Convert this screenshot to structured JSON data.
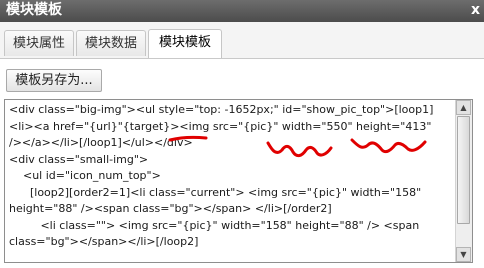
{
  "dialog": {
    "title": "模块模板",
    "close_glyph": "x"
  },
  "tabs": [
    {
      "label": "模块属性",
      "active": false
    },
    {
      "label": "模块数据",
      "active": false
    },
    {
      "label": "模块模板",
      "active": true
    }
  ],
  "toolbar": {
    "save_as_label": "模板另存为..."
  },
  "editor": {
    "lines": [
      "<div class=\"big-img\"><ul style=\"top: -1652px;\" id=\"show_pic_top\">[loop1]",
      "<li><a href=\"{url}\"{target}><img src=\"{pic}\" width=\"550\" height=\"413\"",
      "/></a></li>[/loop1]</ul></div>",
      "<div class=\"small-img\">",
      "    <ul id=\"icon_num_top\">",
      "      [loop2][order2=1]<li class=\"current\"> <img src=\"{pic}\" width=\"158\"",
      "height=\"88\" /><span class=\"bg\"></span> </li>[/order2]",
      "         <li class=\"\"> <img src=\"{pic}\" width=\"158\" height=\"88\" /> <span",
      "class=\"bg\"></span></li>[/loop2]"
    ]
  },
  "annotation": {
    "color": "#e00000"
  }
}
